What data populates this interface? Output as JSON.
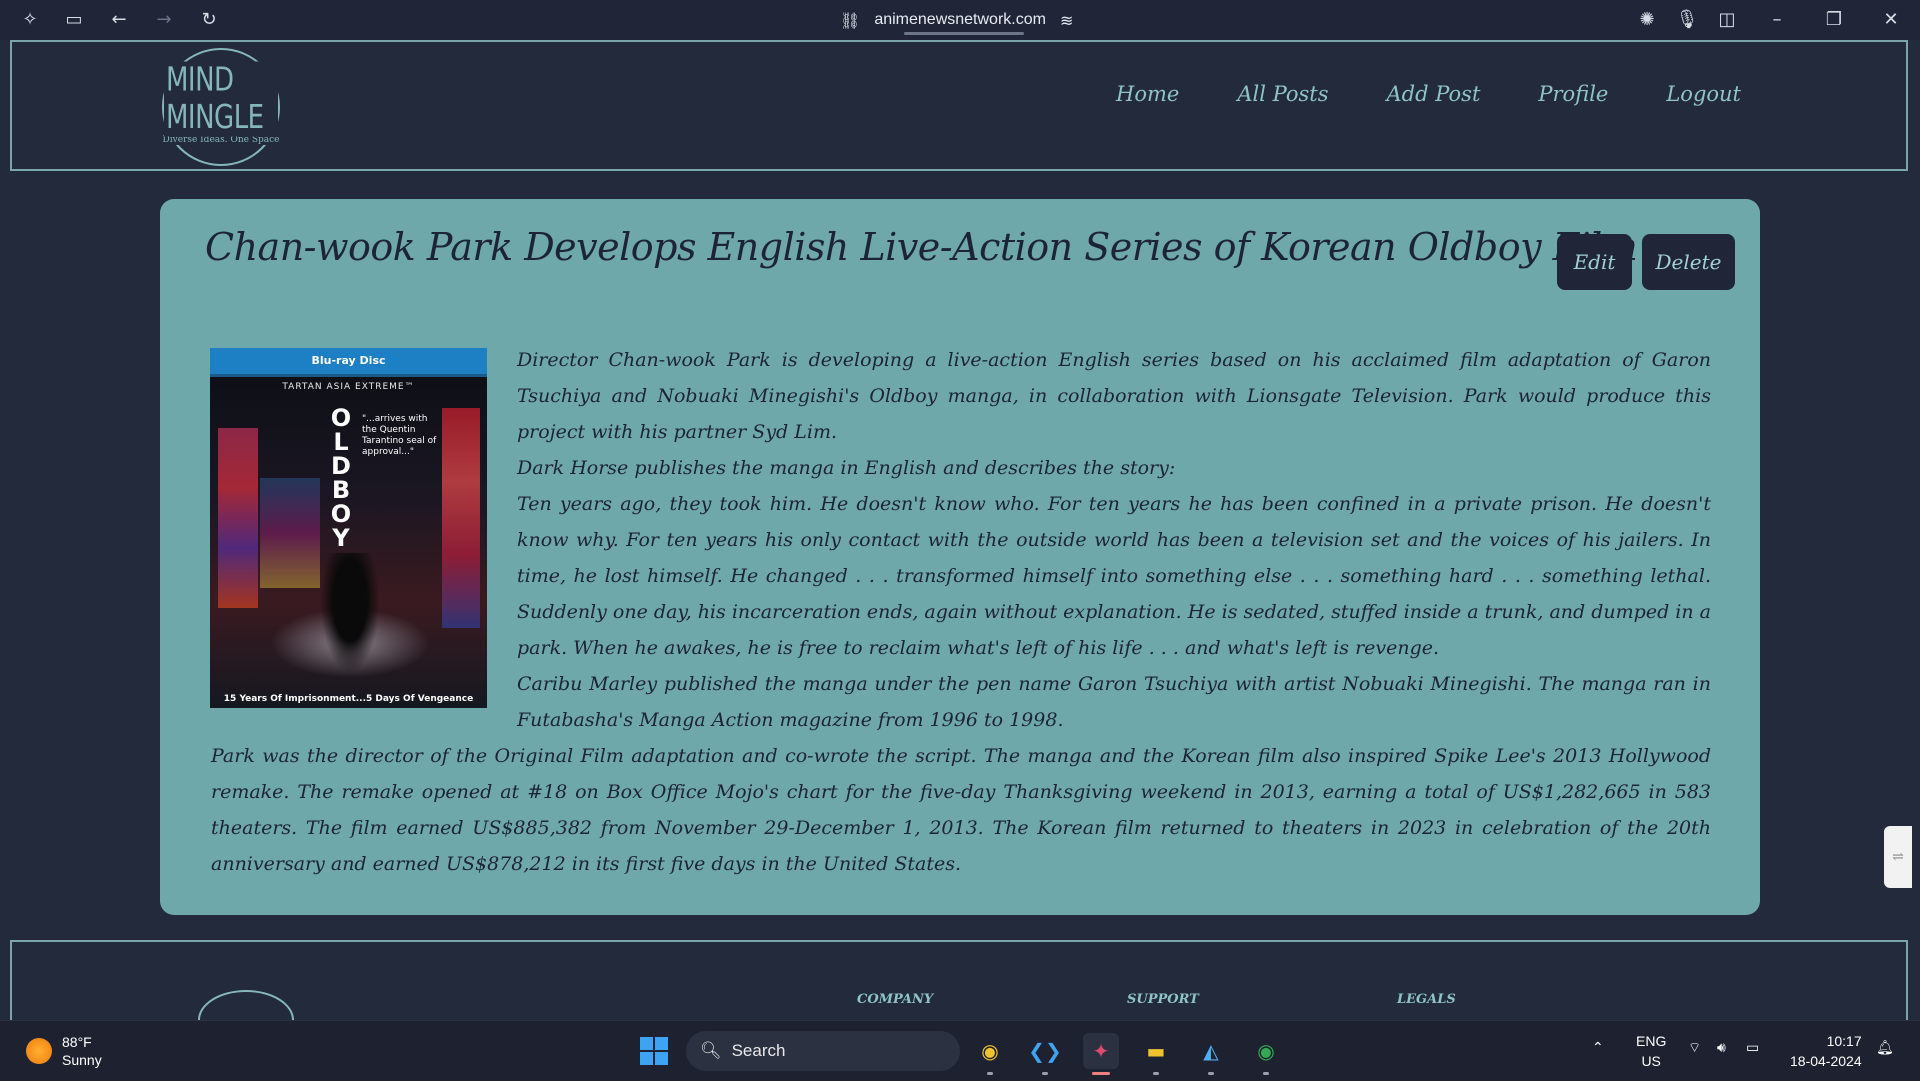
{
  "browser": {
    "url": "animenewsnetwork.com",
    "icons": [
      "copilot-icon",
      "sidebar-icon",
      "back-icon",
      "forward-icon",
      "refresh-icon",
      "link-icon",
      "tune-icon",
      "extensions-icon",
      "mic-icon",
      "split-icon",
      "minimize-icon",
      "maximize-icon",
      "close-icon"
    ]
  },
  "site": {
    "logo_name": "MIND MINGLE",
    "logo_tagline": "Diverse Ideas. One Space",
    "nav": [
      "Home",
      "All Posts",
      "Add Post",
      "Profile",
      "Logout"
    ]
  },
  "post": {
    "title": "Chan-wook Park Develops English Live-Action Series of Korean Oldboy Film",
    "edit_label": "Edit",
    "delete_label": "Delete",
    "cover": {
      "bar": "Blu-ray Disc",
      "series": "TARTAN ASIA EXTREME™",
      "title": "OLDBOY",
      "quote": "\"...arrives with the Quentin Tarantino seal of approval...\"",
      "footer": "15 Years Of Imprisonment...5 Days Of Vengeance"
    },
    "paragraphs": [
      "Director Chan-wook Park is developing a live-action English series based on his acclaimed film adaptation of Garon Tsuchiya and Nobuaki Minegishi's Oldboy manga, in collaboration with Lionsgate Television. Park would produce this project with his partner Syd Lim.",
      "Dark Horse publishes the manga in English and describes the story:",
      "Ten years ago, they took him. He doesn't know who. For ten years he has been confined in a private prison. He doesn't know why. For ten years his only contact with the outside world has been a television set and the voices of his jailers. In time, he lost himself. He changed . . . transformed himself into something else . . . something hard . . . something lethal. Suddenly one day, his incarceration ends, again without explanation. He is sedated, stuffed inside a trunk, and dumped in a park. When he awakes, he is free to reclaim what's left of his life . . . and what's left is revenge.",
      "Caribu Marley published the manga under the pen name Garon Tsuchiya with artist Nobuaki Minegishi. The manga ran in Futabasha's Manga Action magazine from 1996 to 1998.",
      "Park was the director of the Original Film adaptation and co-wrote the script. The manga and the Korean film also inspired Spike Lee's 2013 Hollywood remake. The remake opened at #18 on Box Office Mojo's chart for the five-day Thanksgiving weekend in 2013, earning a total of US$1,282,665 in 583 theaters. The film earned US$885,382 from November 29-December 1, 2013. The Korean film returned to theaters in 2023 in celebration of the 20th anniversary and earned US$878,212 in its first five days in the United States."
    ]
  },
  "footer": {
    "columns": [
      "COMPANY",
      "SUPPORT",
      "LEGALS"
    ]
  },
  "taskbar": {
    "temperature": "88°F",
    "condition": "Sunny",
    "search_placeholder": "Search",
    "language": "ENG",
    "region": "US",
    "time": "10:17",
    "date": "18-04-2024"
  },
  "colors": {
    "page_bg": "#222a3c",
    "card_bg": "#6fa8aa",
    "accent": "#8fc4c6",
    "button_bg": "#202638"
  }
}
